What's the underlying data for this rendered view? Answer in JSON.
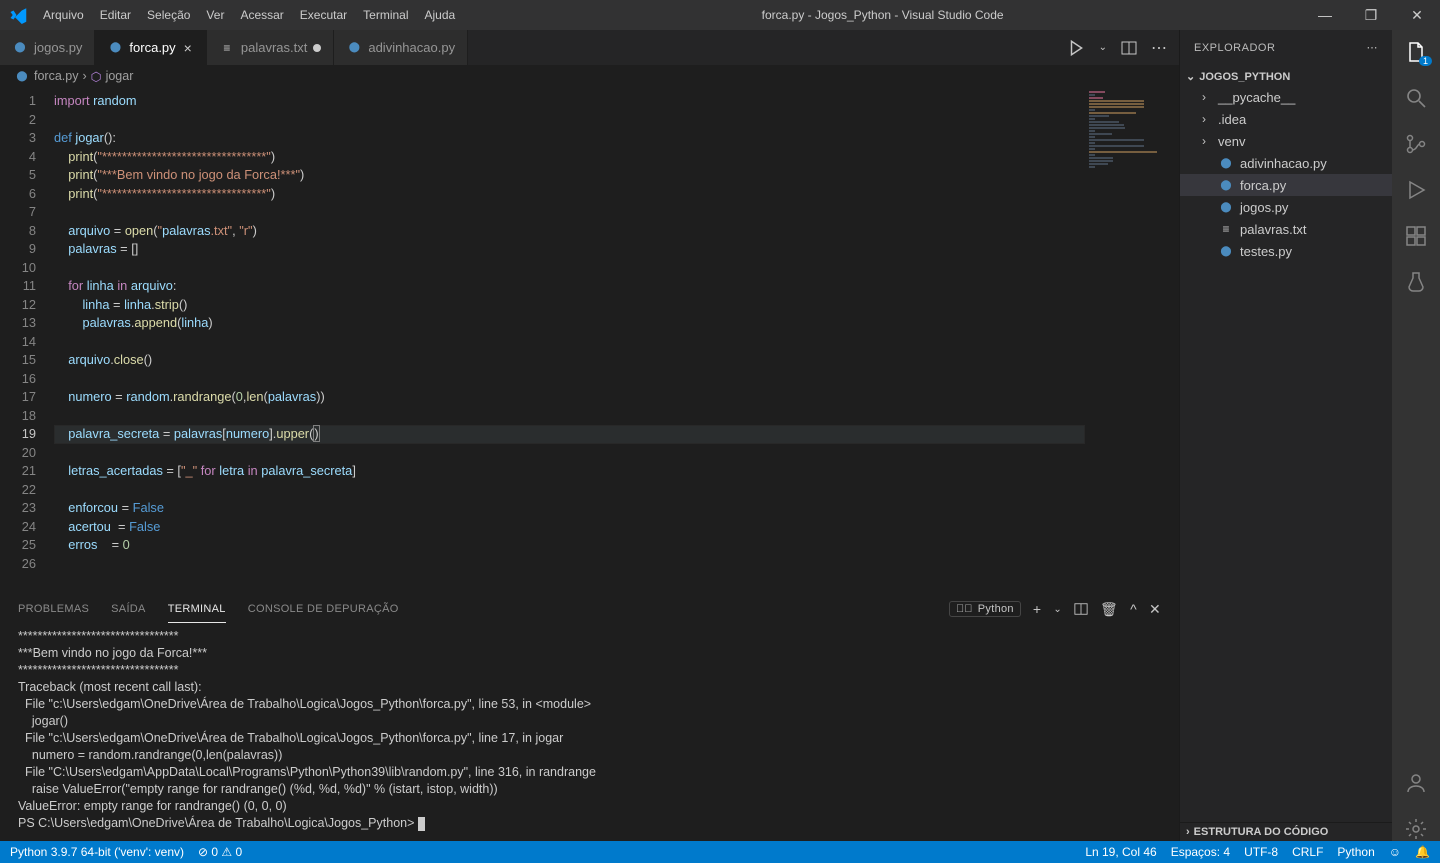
{
  "title": "forca.py - Jogos_Python - Visual Studio Code",
  "menu": [
    "Arquivo",
    "Editar",
    "Seleção",
    "Ver",
    "Acessar",
    "Executar",
    "Terminal",
    "Ajuda"
  ],
  "tabs": [
    {
      "label": "jogos.py",
      "icon": "py",
      "active": false,
      "dirty": false
    },
    {
      "label": "forca.py",
      "icon": "py",
      "active": true,
      "dirty": false
    },
    {
      "label": "palavras.txt",
      "icon": "txt",
      "active": false,
      "dirty": true
    },
    {
      "label": "adivinhacao.py",
      "icon": "py",
      "active": false,
      "dirty": false
    }
  ],
  "breadcrumb": {
    "file": "forca.py",
    "symbol": "jogar"
  },
  "code_lines": [
    "import random",
    "",
    "def jogar():",
    "    print(\"*********************************\")",
    "    print(\"***Bem vindo no jogo da Forca!***\")",
    "    print(\"*********************************\")",
    "",
    "    arquivo = open(\"palavras.txt\", \"r\")",
    "    palavras = []",
    "",
    "    for linha in arquivo:",
    "        linha = linha.strip()",
    "        palavras.append(linha)",
    "",
    "    arquivo.close()",
    "",
    "    numero = random.randrange(0,len(palavras))",
    "",
    "    palavra_secreta = palavras[numero].upper()",
    "",
    "    letras_acertadas = [\"_\" for letra in palavra_secreta]",
    "",
    "    enforcou = False",
    "    acertou  = False",
    "    erros    = 0",
    ""
  ],
  "active_line": 19,
  "panel_tabs": [
    "PROBLEMAS",
    "SAÍDA",
    "TERMINAL",
    "CONSOLE DE DEPURAÇÃO"
  ],
  "panel_active": "TERMINAL",
  "terminal_badge": "Python",
  "terminal_lines": [
    "*********************************",
    "***Bem vindo no jogo da Forca!***",
    "*********************************",
    "Traceback (most recent call last):",
    "  File \"c:\\Users\\edgam\\OneDrive\\Área de Trabalho\\Logica\\Jogos_Python\\forca.py\", line 53, in <module>",
    "    jogar()",
    "  File \"c:\\Users\\edgam\\OneDrive\\Área de Trabalho\\Logica\\Jogos_Python\\forca.py\", line 17, in jogar",
    "    numero = random.randrange(0,len(palavras))",
    "  File \"C:\\Users\\edgam\\AppData\\Local\\Programs\\Python\\Python39\\lib\\random.py\", line 316, in randrange",
    "    raise ValueError(\"empty range for randrange() (%d, %d, %d)\" % (istart, istop, width))",
    "ValueError: empty range for randrange() (0, 0, 0)",
    "PS C:\\Users\\edgam\\OneDrive\\Área de Trabalho\\Logica\\Jogos_Python> "
  ],
  "explorer": {
    "title": "EXPLORADOR",
    "project": "JOGOS_PYTHON",
    "folders": [
      "__pycache__",
      ".idea",
      "venv"
    ],
    "files": [
      {
        "name": "adivinhacao.py",
        "icon": "py"
      },
      {
        "name": "forca.py",
        "icon": "py",
        "active": true
      },
      {
        "name": "jogos.py",
        "icon": "py"
      },
      {
        "name": "palavras.txt",
        "icon": "txt"
      },
      {
        "name": "testes.py",
        "icon": "py"
      }
    ],
    "outline": "ESTRUTURA DO CÓDIGO"
  },
  "status": {
    "interpreter": "Python 3.9.7 64-bit ('venv': venv)",
    "problems": "⊘ 0 ⚠ 0",
    "position": "Ln 19, Col 46",
    "spaces": "Espaços: 4",
    "encoding": "UTF-8",
    "eol": "CRLF",
    "lang": "Python",
    "feedback": "☺",
    "bell": "🔔"
  }
}
